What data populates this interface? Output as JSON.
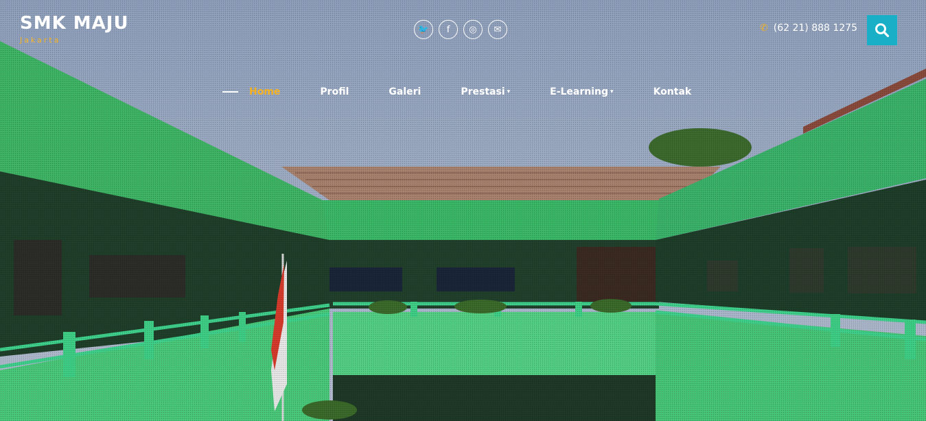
{
  "brand": {
    "title": "SMK MAJU",
    "subtitle": "Jakarta"
  },
  "social": [
    {
      "icon": "twitter-icon",
      "glyph": "🐦"
    },
    {
      "icon": "facebook-icon",
      "glyph": "f"
    },
    {
      "icon": "instagram-icon",
      "glyph": "◎"
    },
    {
      "icon": "email-icon",
      "glyph": "✉"
    }
  ],
  "contact": {
    "phone": "(62 21) 888 1275"
  },
  "nav": {
    "home": "Home",
    "profil": "Profil",
    "galeri": "Galeri",
    "prestasi": "Prestasi",
    "elearning": "E-Learning",
    "kontak": "Kontak"
  },
  "colors": {
    "accent": "#f5b223",
    "search_bg": "#19b0c7",
    "building_green": "#4fcf84",
    "sky": "#9fb0c8"
  }
}
